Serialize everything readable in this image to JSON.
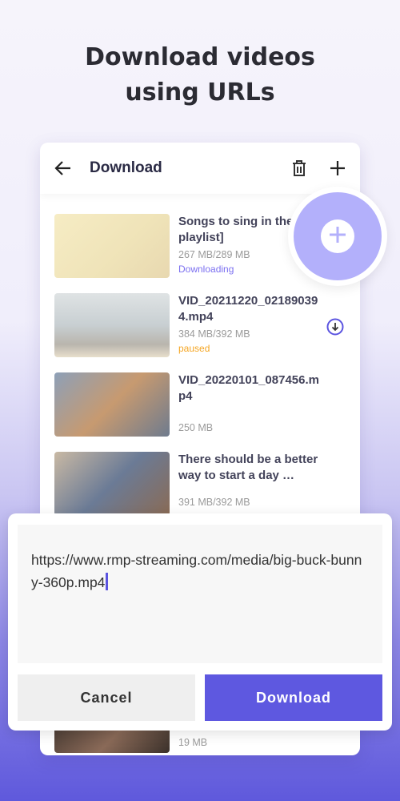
{
  "headline": [
    "Download videos",
    "using URLs"
  ],
  "header": {
    "title": "Download",
    "back_icon": "arrow-left-icon",
    "delete_icon": "trash-icon",
    "add_icon": "plus-icon"
  },
  "items": [
    {
      "name": "Songs to sing in the [vibe playlist]",
      "size": "267 MB/289 MB",
      "status": "Downloading",
      "status_color": "#7b6ff0",
      "thumb": "linear-gradient(135deg,#f6ecc4,#efe3b8 60%,#e8d8b0)"
    },
    {
      "name": "VID_20211220_021890394.mp4",
      "size": "384 MB/392 MB",
      "status": "paused",
      "status_color": "#f5a623",
      "thumb": "linear-gradient(180deg,#dfe3e4,#c8cfd2 50%,#b9b5ad 80%,#e8dfcc)"
    },
    {
      "name": "VID_20220101_087456.mp4",
      "size": "250 MB",
      "status": "",
      "thumb": "linear-gradient(135deg,#8da0b8,#c79a70 50%,#6e7b8e)"
    },
    {
      "name": "There should be a better way to start a day …",
      "size": "391 MB/392 MB",
      "status": "",
      "thumb": "linear-gradient(135deg,#c9b9a4,#6b7b96 50%,#8a6b55)"
    },
    {
      "name": "",
      "size": "19 MB",
      "status": "",
      "thumb": "linear-gradient(135deg,#2a2522,#8a6a58 60%,#3a302a)"
    }
  ],
  "fab": {
    "icon": "plus-icon"
  },
  "dialog": {
    "url": "https://www.rmp-streaming.com/media/big-buck-bunny-360p.mp4",
    "cancel": "Cancel",
    "download": "Download"
  },
  "colors": {
    "accent": "#5e58e0",
    "fab": "#b3b0fb"
  }
}
